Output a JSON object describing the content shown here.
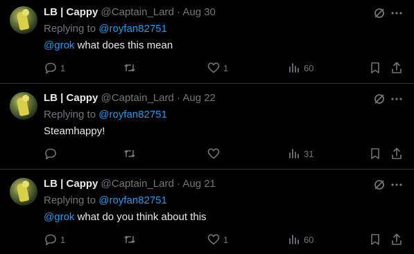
{
  "tweets": [
    {
      "name": "LB | Cappy",
      "handle": "@Captain_Lard",
      "sep": "·",
      "date": "Aug 30",
      "replying_prefix": "Replying to ",
      "replying_to": "@royfan82751",
      "body_mention": "@grok",
      "body_text": " what does this mean",
      "replies": "1",
      "retweets": "",
      "likes": "1",
      "views": "60"
    },
    {
      "name": "LB | Cappy",
      "handle": "@Captain_Lard",
      "sep": "·",
      "date": "Aug 22",
      "replying_prefix": "Replying to ",
      "replying_to": "@royfan82751",
      "body_mention": "",
      "body_text": "Steamhappy!",
      "replies": "",
      "retweets": "",
      "likes": "",
      "views": "31"
    },
    {
      "name": "LB | Cappy",
      "handle": "@Captain_Lard",
      "sep": "·",
      "date": "Aug 21",
      "replying_prefix": "Replying to ",
      "replying_to": "@royfan82751",
      "body_mention": "@grok",
      "body_text": " what do you think about this",
      "replies": "1",
      "retweets": "",
      "likes": "1",
      "views": "60"
    }
  ],
  "colors": {
    "background": "#000000",
    "text": "#e7e9ea",
    "muted": "#71767b",
    "accent": "#1d9bf0",
    "divider": "#2f3336"
  },
  "icons": [
    "grok-icon",
    "more-icon",
    "reply-icon",
    "retweet-icon",
    "like-icon",
    "views-icon",
    "bookmark-icon",
    "share-icon"
  ]
}
